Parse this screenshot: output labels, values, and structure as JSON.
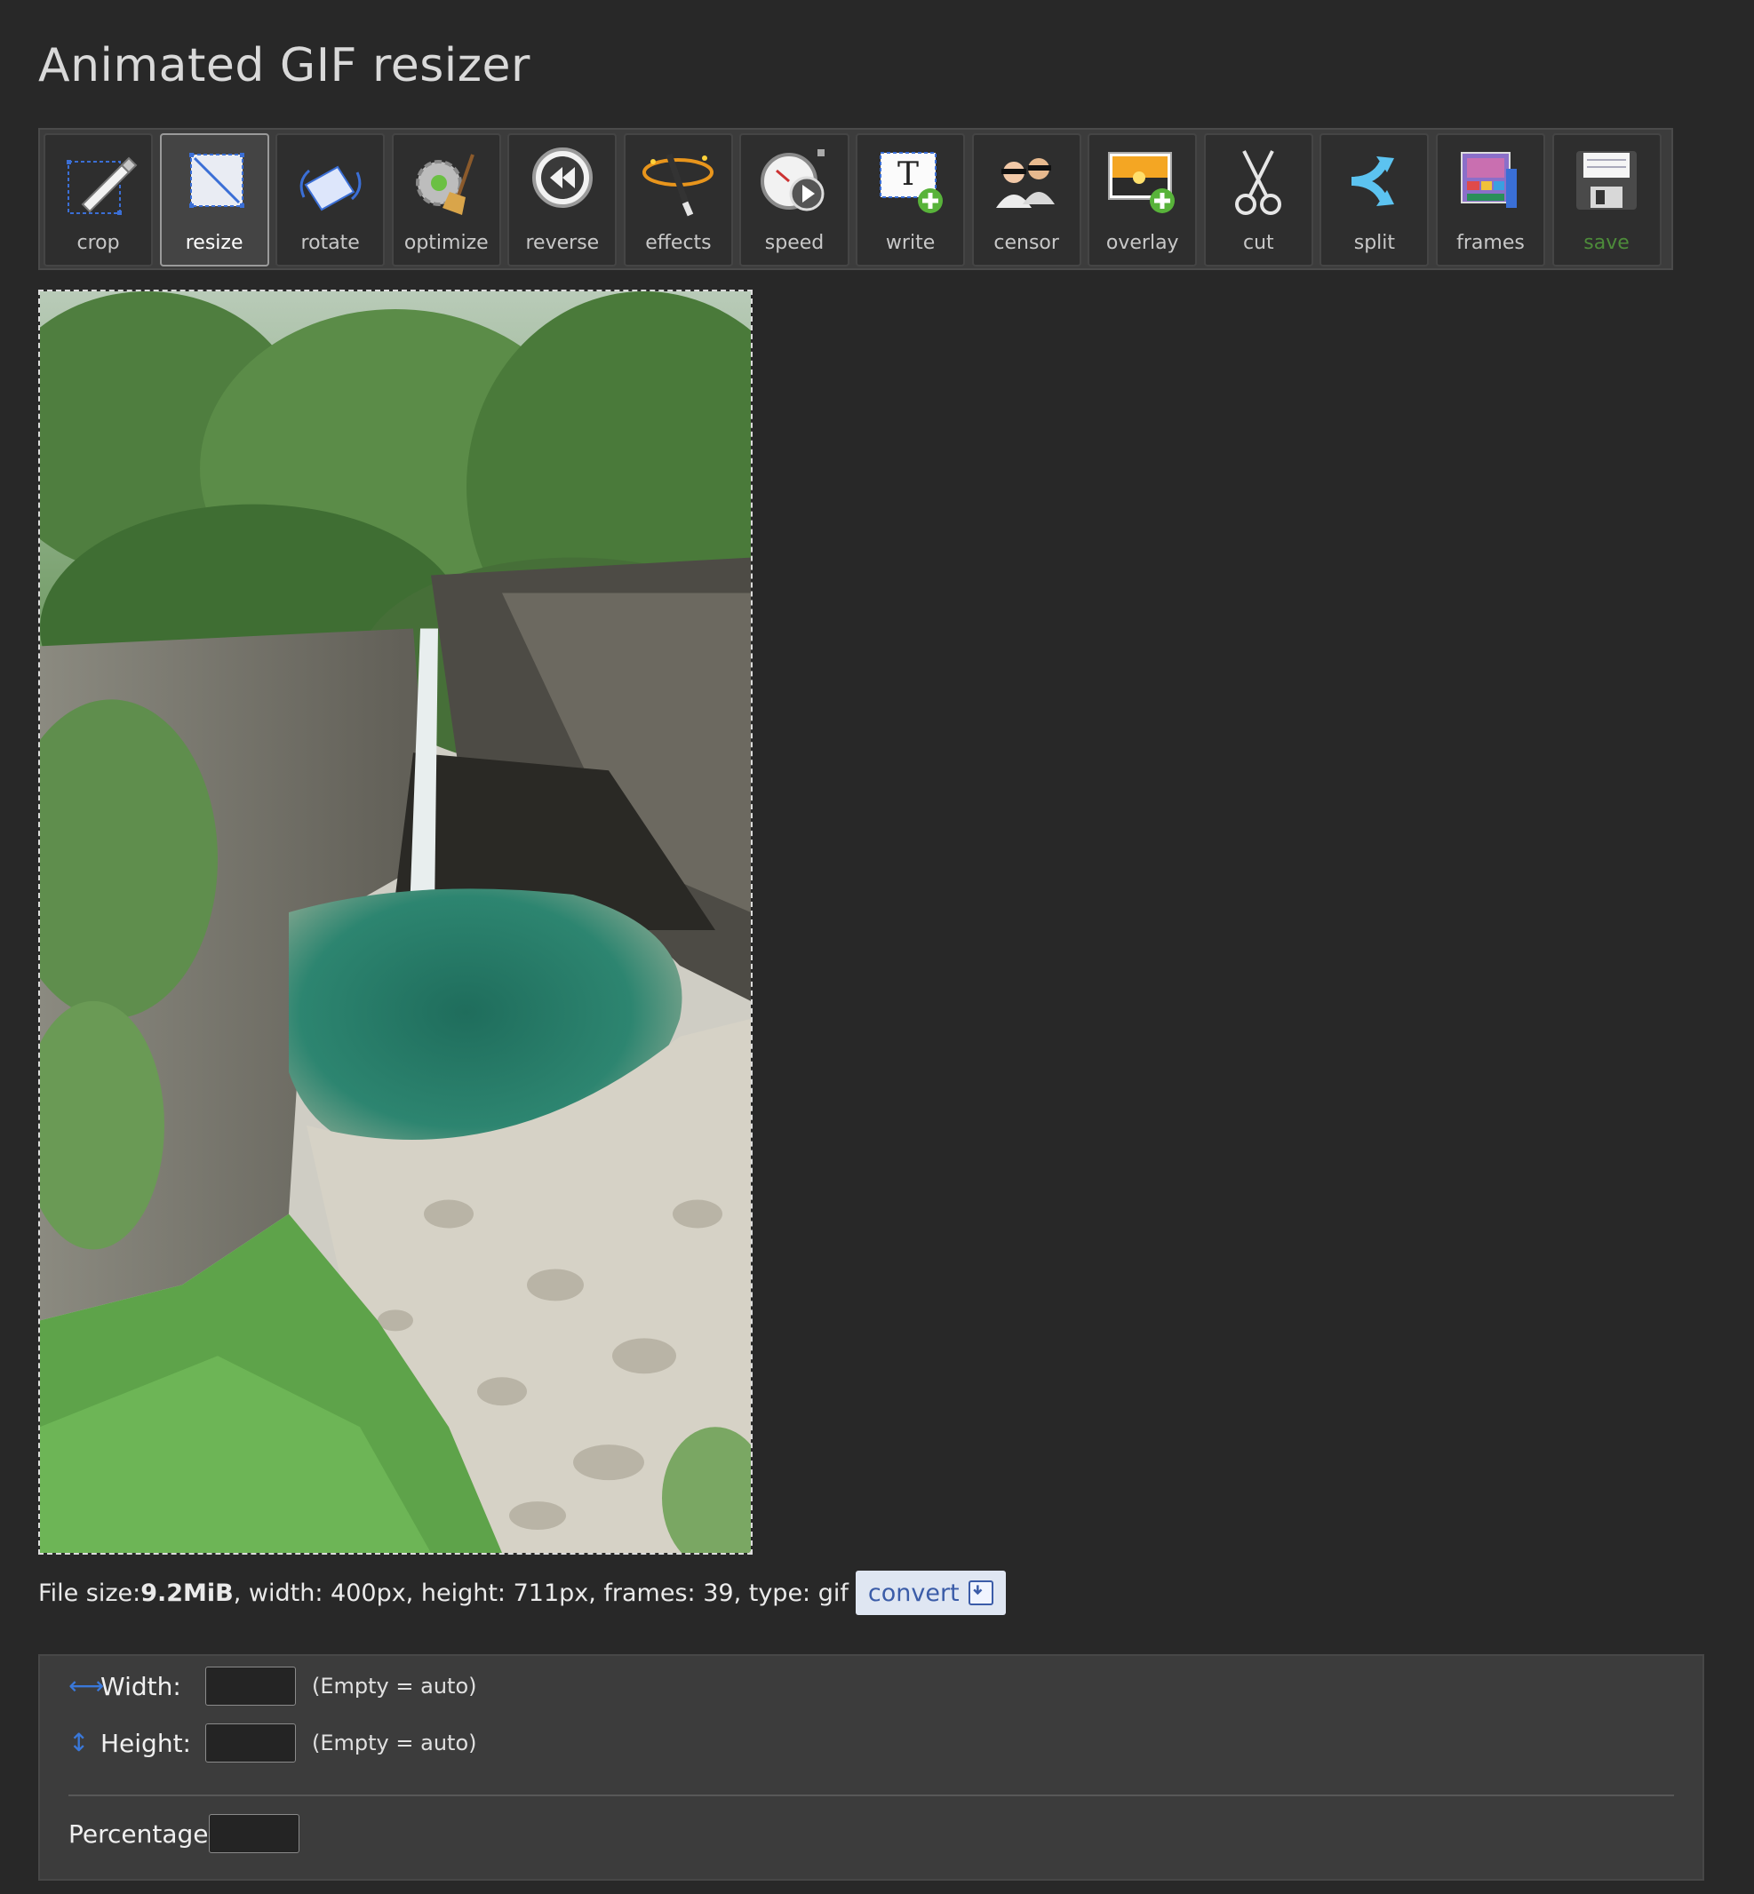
{
  "page_title": "Animated GIF resizer",
  "toolbar": [
    {
      "label": "crop",
      "icon": "crop-icon",
      "active": false
    },
    {
      "label": "resize",
      "icon": "resize-icon",
      "active": true
    },
    {
      "label": "rotate",
      "icon": "rotate-icon",
      "active": false
    },
    {
      "label": "optimize",
      "icon": "optimize-icon",
      "active": false
    },
    {
      "label": "reverse",
      "icon": "reverse-icon",
      "active": false
    },
    {
      "label": "effects",
      "icon": "effects-icon",
      "active": false
    },
    {
      "label": "speed",
      "icon": "speed-icon",
      "active": false
    },
    {
      "label": "write",
      "icon": "write-icon",
      "active": false
    },
    {
      "label": "censor",
      "icon": "censor-icon",
      "active": false
    },
    {
      "label": "overlay",
      "icon": "overlay-icon",
      "active": false
    },
    {
      "label": "cut",
      "icon": "scissors-icon",
      "active": false
    },
    {
      "label": "split",
      "icon": "split-icon",
      "active": false
    },
    {
      "label": "frames",
      "icon": "frames-icon",
      "active": false
    },
    {
      "label": "save",
      "icon": "floppy-disk-icon",
      "active": false
    }
  ],
  "file_info": {
    "prefix": "File size: ",
    "size": "9.2MiB",
    "rest": ", width: 400px, height: 711px, frames: 39, type: gif",
    "convert_label": "convert"
  },
  "form": {
    "width_label": "Width:",
    "height_label": "Height:",
    "percentage_label": "Percentage:",
    "empty_hint": "(Empty = auto)",
    "width_value": "",
    "height_value": "",
    "percentage_value": ""
  },
  "colors": {
    "background": "#282828",
    "save_label": "#4d8b3a",
    "convert_text": "#3b5ca8",
    "accent_icon": "#3a78d9"
  }
}
